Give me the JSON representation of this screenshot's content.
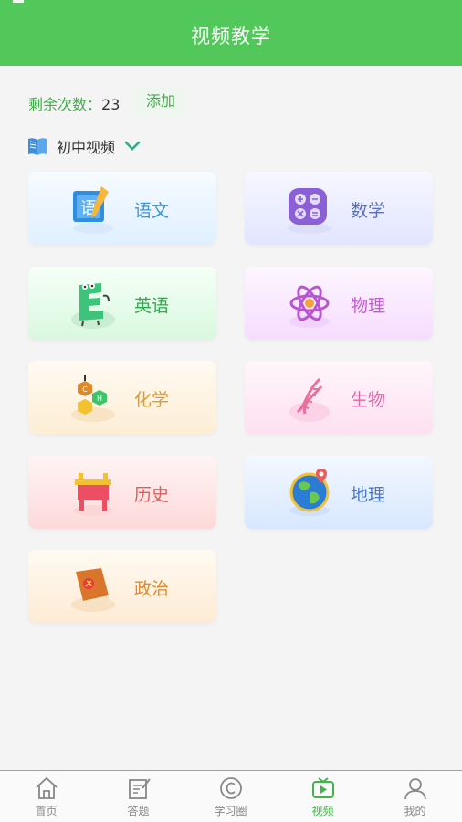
{
  "header": {
    "title": "视频教学"
  },
  "remain": {
    "label": "剩余次数：",
    "value": "23",
    "add_label": "添加"
  },
  "level": {
    "label": "初中视频"
  },
  "subjects": [
    {
      "name": "语文",
      "color": "#3a96d9"
    },
    {
      "name": "数学",
      "color": "#5a6fb8"
    },
    {
      "name": "英语",
      "color": "#2ea84a"
    },
    {
      "name": "物理",
      "color": "#c55bd6"
    },
    {
      "name": "化学",
      "color": "#e39a2b"
    },
    {
      "name": "生物",
      "color": "#e064a6"
    },
    {
      "name": "历史",
      "color": "#e25a5a"
    },
    {
      "name": "地理",
      "color": "#4a78c4"
    },
    {
      "name": "政治",
      "color": "#e38a2b"
    }
  ],
  "tabs": [
    {
      "label": "首页",
      "active": false
    },
    {
      "label": "答题",
      "active": false
    },
    {
      "label": "学习圈",
      "active": false
    },
    {
      "label": "视频",
      "active": true
    },
    {
      "label": "我的",
      "active": false
    }
  ],
  "colors": {
    "brand": "#52c75a",
    "active_tab": "#43b34b"
  }
}
